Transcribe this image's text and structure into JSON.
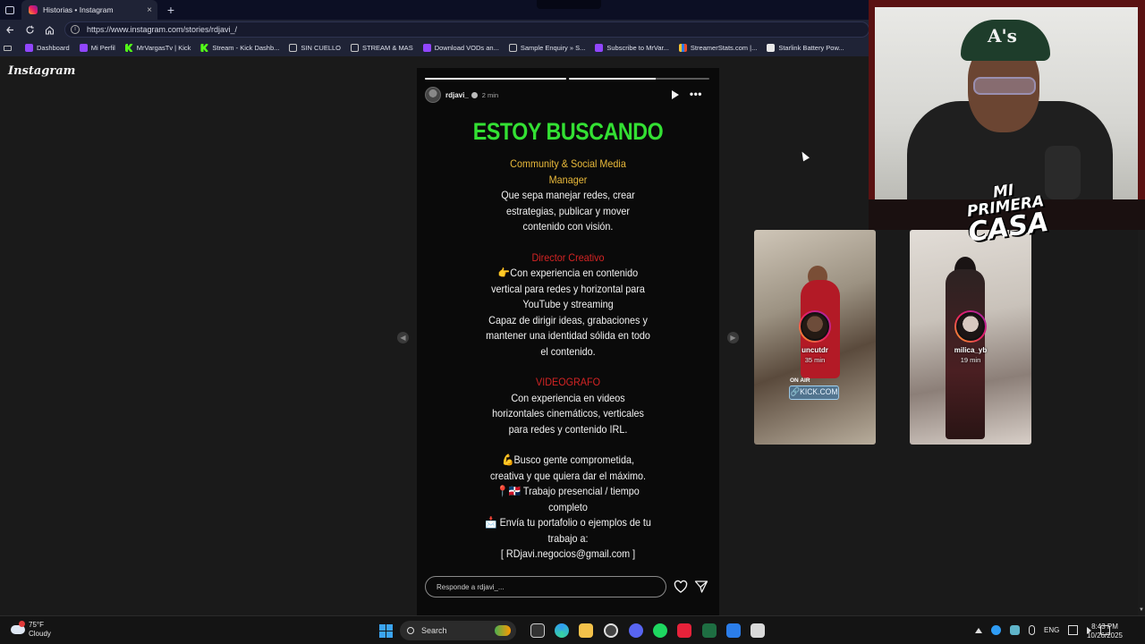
{
  "browser": {
    "tab_title": "Historias • Instagram",
    "new_tab_symbol": "+",
    "close_symbol": "×",
    "url": "https://www.instagram.com/stories/rdjavi_/",
    "bookmarks": [
      {
        "label": "Dashboard",
        "icon": "twitch-icon"
      },
      {
        "label": "Mi Perfil",
        "icon": "twitch-icon"
      },
      {
        "label": "MrVargasTv | Kick",
        "icon": "kick-icon"
      },
      {
        "label": "Stream - Kick Dashb...",
        "icon": "kick-icon"
      },
      {
        "label": "SIN CUELLO",
        "icon": "folder-icon"
      },
      {
        "label": "STREAM & MAS",
        "icon": "folder-icon"
      },
      {
        "label": "Download VODs an...",
        "icon": "twitch-icon"
      },
      {
        "label": "Sample Enquiry » S...",
        "icon": "globe-icon"
      },
      {
        "label": "Subscribe to MrVar...",
        "icon": "twitch-icon"
      },
      {
        "label": "StreamerStats.com |...",
        "icon": "chart-icon"
      },
      {
        "label": "Starlink Battery Pow...",
        "icon": "document-icon"
      }
    ]
  },
  "instagram": {
    "logo": "Instagram",
    "story": {
      "username": "rdjavi_",
      "time": "2 min",
      "progress": [
        1.0,
        0.62
      ],
      "headline": "ESTOY BUSCANDO",
      "lines": [
        {
          "text": "Community & Social Media",
          "style": "gold"
        },
        {
          "text": "Manager",
          "style": "gold"
        },
        {
          "text": "Que sepa manejar redes, crear",
          "style": "white"
        },
        {
          "text": "estrategias, publicar y mover",
          "style": "white"
        },
        {
          "text": "contenido con visión.",
          "style": "white"
        },
        {
          "text": "",
          "style": "gap"
        },
        {
          "text": "Director Creativo",
          "style": "red"
        },
        {
          "text": "👉Con experiencia en contenido",
          "style": "white"
        },
        {
          "text": "vertical para redes  y horizontal para",
          "style": "white"
        },
        {
          "text": "YouTube y streaming",
          "style": "white"
        },
        {
          "text": "Capaz de dirigir ideas, grabaciones y",
          "style": "white"
        },
        {
          "text": "mantener una identidad sólida en todo",
          "style": "white"
        },
        {
          "text": "el contenido.",
          "style": "white"
        },
        {
          "text": "",
          "style": "gap"
        },
        {
          "text": "VIDEOGRAFO",
          "style": "red"
        },
        {
          "text": "Con experiencia en videos",
          "style": "white"
        },
        {
          "text": "horizontales cinemáticos, verticales",
          "style": "white"
        },
        {
          "text": "para redes y contenido IRL.",
          "style": "white"
        },
        {
          "text": "",
          "style": "gap"
        },
        {
          "text": "💪Busco gente comprometida,",
          "style": "white"
        },
        {
          "text": "creativa y que quiera dar el máximo.",
          "style": "white"
        },
        {
          "text": "📍🇩🇴 Trabajo presencial / tiempo",
          "style": "white"
        },
        {
          "text": "completo",
          "style": "white"
        },
        {
          "text": "📩 Envía tu portafolio o ejemplos de tu",
          "style": "white"
        },
        {
          "text": "trabajo a:",
          "style": "white"
        },
        {
          "text": "[ RDjavi.negocios@gmail.com ]",
          "style": "white"
        }
      ],
      "reply_placeholder": "Responde a rdjavi_..."
    },
    "previews": [
      {
        "username": "uncutdr",
        "time": "35 min",
        "on_air": "ON AIR",
        "badge": "🔗KICK.COM"
      },
      {
        "username": "milica_yb",
        "time": "19 min"
      }
    ]
  },
  "overlay": {
    "brand_line1": "MI PRIMERA",
    "brand_line2": "CASA",
    "cap_logo": "A's"
  },
  "taskbar": {
    "temperature": "75°F",
    "condition": "Cloudy",
    "search_label": "Search",
    "language": "ENG",
    "time": "8:43 PM",
    "date": "10/26/2025"
  },
  "colors": {
    "headline": "#33e033",
    "gold": "#e9b93a",
    "red": "#d42424",
    "chrome": "#1f2336",
    "accent_start": "#3ba4f2"
  }
}
